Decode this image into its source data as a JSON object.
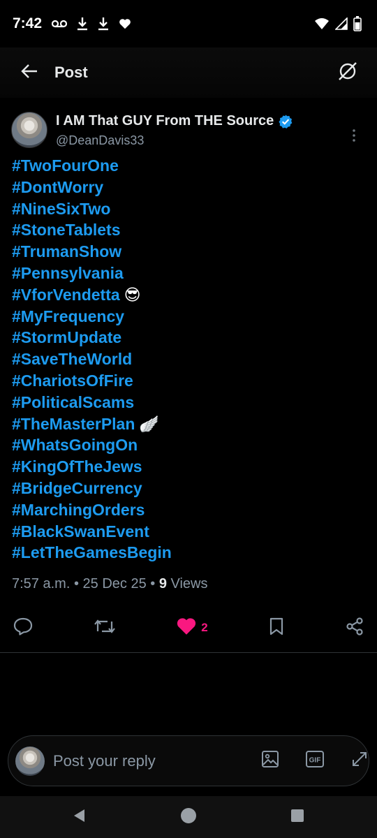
{
  "status_bar": {
    "time": "7:42",
    "icons_left": [
      "voicemail-icon",
      "download-icon",
      "download-icon",
      "heart-icon"
    ],
    "icons_right": [
      "wifi-icon",
      "signal-icon",
      "battery-icon"
    ]
  },
  "header": {
    "title": "Post",
    "back_icon": "arrow-left-icon",
    "right_icon": "grok-icon"
  },
  "post": {
    "author": {
      "display_name": "I AM That GUY From THE Source",
      "handle": "@DeanDavis33",
      "verified": true
    },
    "hashtags": [
      {
        "text": "#TwoFourOne",
        "emoji": ""
      },
      {
        "text": "#DontWorry",
        "emoji": ""
      },
      {
        "text": "#NineSixTwo",
        "emoji": ""
      },
      {
        "text": "#StoneTablets",
        "emoji": ""
      },
      {
        "text": "#TrumanShow",
        "emoji": ""
      },
      {
        "text": "#Pennsylvania",
        "emoji": ""
      },
      {
        "text": "#VforVendetta",
        "emoji": "😎"
      },
      {
        "text": "#MyFrequency",
        "emoji": ""
      },
      {
        "text": "#StormUpdate",
        "emoji": ""
      },
      {
        "text": "#SaveTheWorld",
        "emoji": ""
      },
      {
        "text": "#ChariotsOfFire",
        "emoji": ""
      },
      {
        "text": "#PoliticalScams",
        "emoji": ""
      },
      {
        "text": "#TheMasterPlan",
        "emoji": "🪽"
      },
      {
        "text": "#WhatsGoingOn",
        "emoji": ""
      },
      {
        "text": "#KingOfTheJews",
        "emoji": ""
      },
      {
        "text": "#BridgeCurrency",
        "emoji": ""
      },
      {
        "text": "#MarchingOrders",
        "emoji": ""
      },
      {
        "text": "#BlackSwanEvent",
        "emoji": ""
      },
      {
        "text": "#LetTheGamesBegin",
        "emoji": ""
      }
    ],
    "meta": {
      "time": "7:57 a.m.",
      "separator": " • ",
      "date": "25 Dec 25",
      "views_count": "9",
      "views_label": " Views"
    },
    "actions": {
      "like_count": "2"
    }
  },
  "reply": {
    "placeholder": "Post your reply",
    "gif_label": "GIF"
  },
  "colors": {
    "accent": "#1d9bf0",
    "like": "#f91880",
    "muted": "#8b98a5",
    "background": "#000000"
  }
}
